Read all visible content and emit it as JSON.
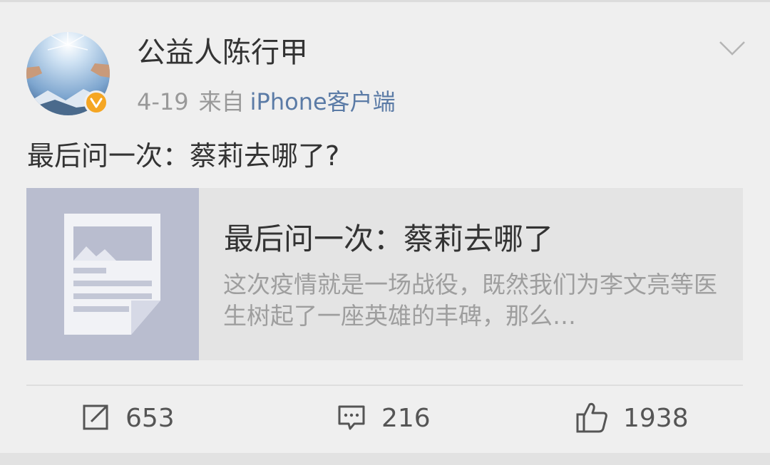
{
  "post": {
    "username": "公益人陈行甲",
    "date": "4-19",
    "source_prefix": "来自",
    "source_client": "iPhone客户端",
    "text": "最后问一次：蔡莉去哪了?",
    "verified_badge": "V"
  },
  "card": {
    "title": "最后问一次：蔡莉去哪了",
    "description": "这次疫情就是一场战役，既然我们为李文亮等医生树起了一座英雄的丰碑，那么…"
  },
  "actions": {
    "repost_count": "653",
    "comment_count": "216",
    "like_count": "1938"
  },
  "icons": {
    "more": "chevron-down-icon",
    "repost": "share-icon",
    "comment": "comment-icon",
    "like": "thumbs-up-icon"
  },
  "colors": {
    "background": "#efefef",
    "source_link": "#5b7ba6",
    "verified": "#f5a623",
    "card_bg": "#e4e4e4",
    "thumb_bg": "#b9bdcf"
  }
}
